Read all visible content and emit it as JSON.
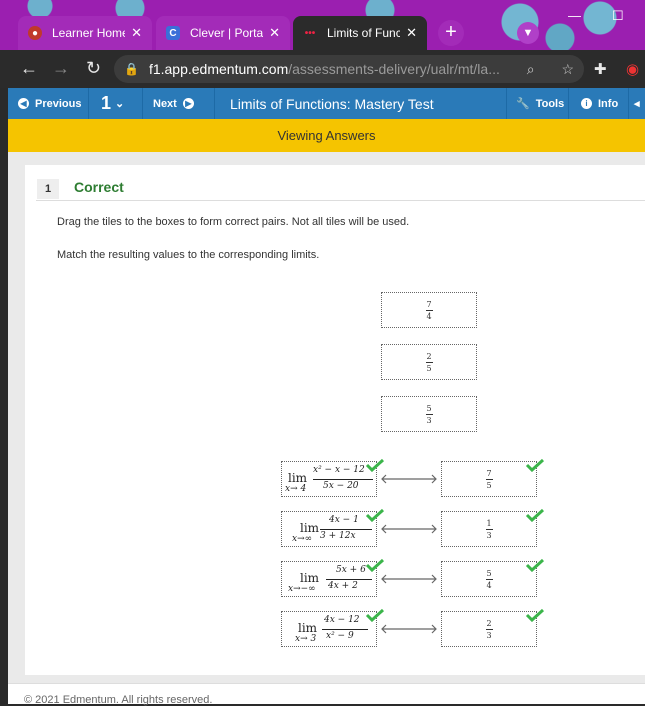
{
  "browser": {
    "tabs": [
      {
        "label": "Learner Home",
        "icon": "edmentum-icon"
      },
      {
        "label": "Clever | Portal",
        "icon": "clever-icon"
      },
      {
        "label": "Limits of Func",
        "icon": "edmentum-dots-icon"
      }
    ],
    "url_host": "f1.app.edmentum.com",
    "url_path": "/assessments-delivery/ualr/mt/la...",
    "colors": {
      "tabbar": "#9b1fb0",
      "active_tab": "#2b2b2b"
    }
  },
  "toolbar": {
    "previous_label": "Previous",
    "question_number": "1",
    "next_label": "Next",
    "test_title": "Limits of Functions: Mastery Test",
    "tools_label": "Tools",
    "info_label": "Info",
    "colors": {
      "toolbar": "#2a7ab8",
      "banner": "#f5c400"
    }
  },
  "banner_text": "Viewing Answers",
  "question": {
    "number": "1",
    "status": "Correct",
    "instruction1": "Drag the tiles to the boxes to form correct pairs. Not all tiles will be used.",
    "instruction2": "Match the resulting values to the corresponding limits."
  },
  "unused_tiles": [
    {
      "num": "7",
      "den": "4"
    },
    {
      "num": "2",
      "den": "5"
    },
    {
      "num": "5",
      "den": "3"
    }
  ],
  "pairs": [
    {
      "lim_top": "lim",
      "lim_sub": "x→ 4",
      "expr_num": "x² − x − 12",
      "expr_den": "5x − 20",
      "answer_num": "7",
      "answer_den": "5",
      "correct": true
    },
    {
      "lim_top": "lim",
      "lim_sub": "x→∞",
      "expr_num": "4x − 1",
      "expr_den": "3 + 12x",
      "answer_num": "1",
      "answer_den": "3",
      "correct": true
    },
    {
      "lim_top": "lim",
      "lim_sub": "x→−∞",
      "expr_num": "5x + 6",
      "expr_den": "4x + 2",
      "answer_num": "5",
      "answer_den": "4",
      "correct": true
    },
    {
      "lim_top": "lim",
      "lim_sub": "x→ 3",
      "expr_num": "4x − 12",
      "expr_den": "x² − 9",
      "answer_num": "2",
      "answer_den": "3",
      "correct": true
    }
  ],
  "footer": "© 2021 Edmentum. All rights reserved."
}
